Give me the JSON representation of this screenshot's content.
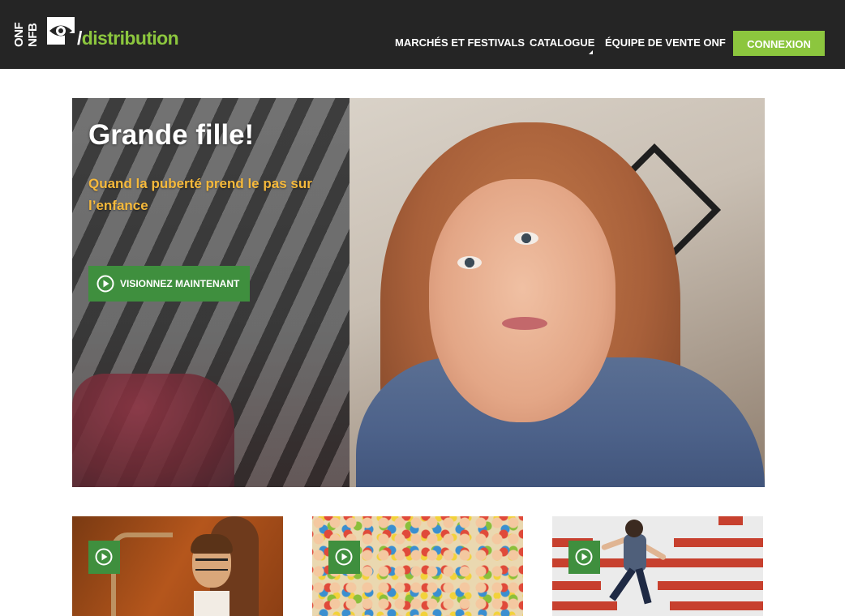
{
  "header": {
    "logo": {
      "onf_row1": "ONF",
      "onf_row2": "NFB",
      "slash": "/",
      "site_name": "distribution"
    },
    "nav": {
      "markets": "MARCHÉS ET FESTIVALS",
      "catalogue": "CATALOGUE",
      "team": "ÉQUIPE DE VENTE ONF"
    },
    "login_button": "CONNEXION"
  },
  "hero": {
    "title": "Grande fille!",
    "subtitle": "Quand la puberté prend le pas sur l’enfance",
    "cta_label": "VISIONNEZ MAINTENANT"
  },
  "thumbnails": [
    {
      "icon": "play-icon"
    },
    {
      "icon": "play-icon"
    },
    {
      "icon": "play-icon"
    }
  ],
  "colors": {
    "header_bg": "#252525",
    "brand_green": "#8cc63e",
    "cta_green": "#3f8f3e",
    "subtitle_orange": "#f6b93b"
  }
}
